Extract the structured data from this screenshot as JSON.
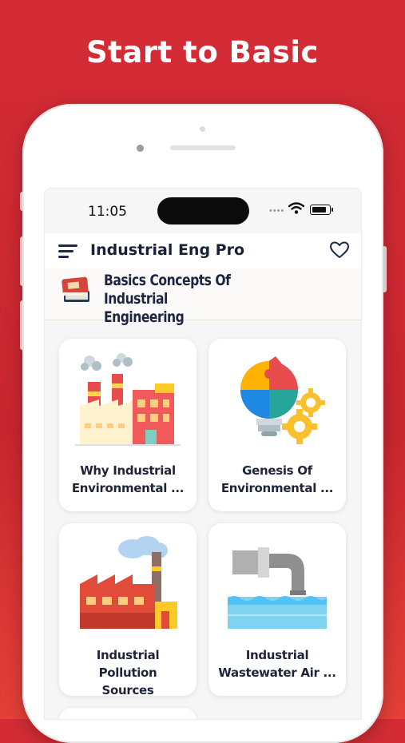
{
  "promo": {
    "headline": "Start to Basic"
  },
  "status_bar": {
    "time": "11:05",
    "signal": "••••"
  },
  "app_bar": {
    "title": "Industrial Eng Pro",
    "menu_icon": "hamburger-icon",
    "favorite_icon": "heart-icon"
  },
  "section": {
    "title_line1": "Basics Concepts Of Industrial",
    "title_line2": "Engineering",
    "icon": "book-icon"
  },
  "cards": [
    {
      "line1": "Why Industrial",
      "line2": "Environmental ...",
      "icon": "factory-building-icon"
    },
    {
      "line1": "Genesis Of",
      "line2": "Environmental ...",
      "icon": "lightbulb-puzzle-gear-icon"
    },
    {
      "line1": "Industrial Pollution",
      "line2": "Sources",
      "icon": "factory-smoke-icon"
    },
    {
      "line1": "Industrial",
      "line2": "Wastewater Air ...",
      "icon": "pipe-water-icon"
    }
  ],
  "colors": {
    "background": "#d42c36",
    "title": "#1a2238",
    "card": "#ffffff"
  }
}
